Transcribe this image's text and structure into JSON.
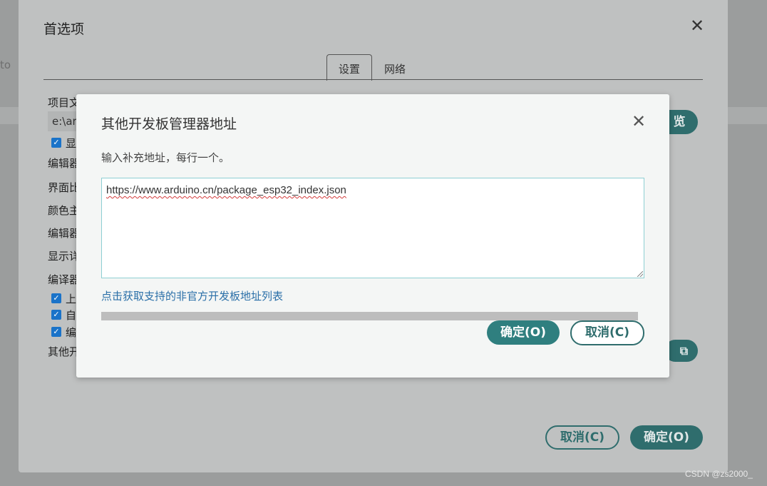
{
  "background": {
    "left_text": "to"
  },
  "preferences": {
    "title": "首选项",
    "tabs": [
      {
        "label": "设置",
        "active": true
      },
      {
        "label": "网络",
        "active": false
      }
    ],
    "rows": {
      "sketchbook": "项目文",
      "path_value": "e:\\arc",
      "show_checkbox": "显",
      "editor_font": "编辑器",
      "ui_scale": "界面比",
      "theme": "颜色主",
      "editor_lang": "编辑器",
      "verbose": "显示详",
      "compiler": "编译器",
      "check_upload": "上",
      "check_auto": "自",
      "check_compile": "编",
      "other_boards": "其他开"
    },
    "browse_button": "览",
    "cancel_button": "取消(C)",
    "ok_button": "确定(O)"
  },
  "dialog": {
    "title": "其他开发板管理器地址",
    "hint": "输入补充地址，每行一个。",
    "textarea_value": "https://www.arduino.cn/package_esp32_index.json",
    "link": "点击获取支持的非官方开发板地址列表",
    "progress": 1.0,
    "ok_button": "确定(O)",
    "cancel_button": "取消(C)"
  },
  "colors": {
    "accent": "#2f6d6d",
    "link": "#2a6fa8",
    "checkbox": "#1a73c9"
  },
  "watermark": "CSDN @zs2000_"
}
